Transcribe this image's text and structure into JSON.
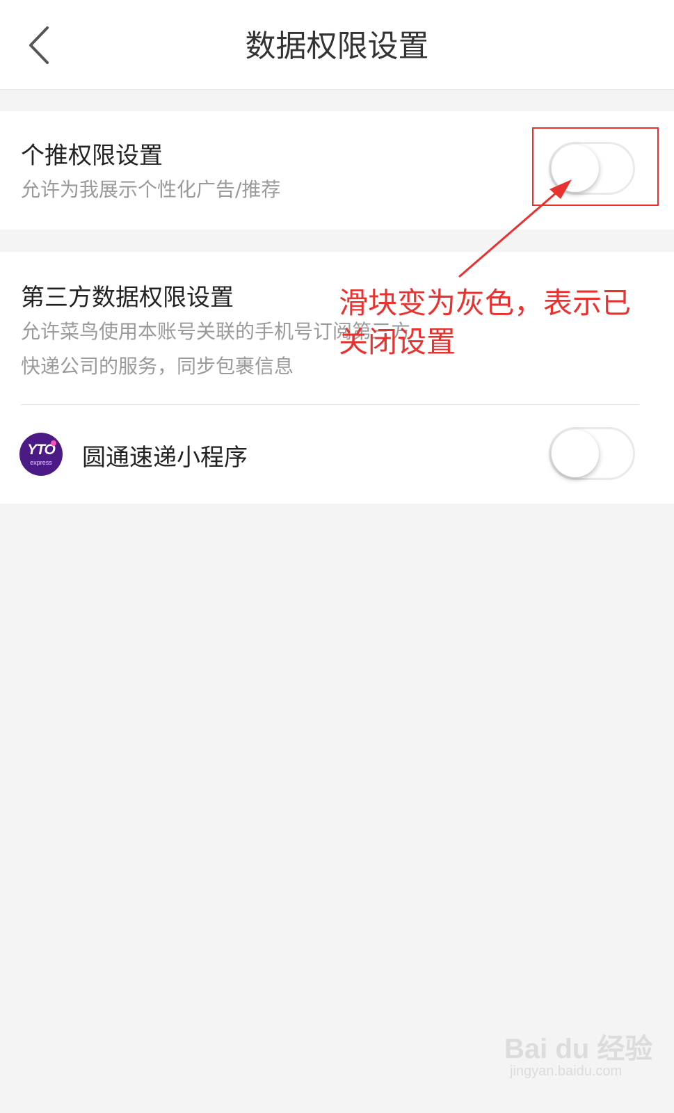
{
  "navbar": {
    "title": "数据权限设置",
    "back_icon": "chevron-left-icon"
  },
  "personalized": {
    "title": "个推权限设置",
    "description": "允许为我展示个性化广告/推荐",
    "toggle_on": false
  },
  "third_party": {
    "title": "第三方数据权限设置",
    "description_line1": "允许菜鸟使用本账号关联的手机号订阅第三方",
    "description_line2": "快递公司的服务，同步包裹信息",
    "items": [
      {
        "logo_text": "YTO",
        "logo_sub": "express",
        "label": "圆通速递小程序",
        "toggle_on": false
      }
    ]
  },
  "annotation": {
    "line1": "滑块变为灰色，表示已",
    "line2": "关闭设置",
    "color": "#e8322f"
  },
  "watermark": {
    "brand": "Bai du 经验",
    "url": "jingyan.baidu.com"
  }
}
